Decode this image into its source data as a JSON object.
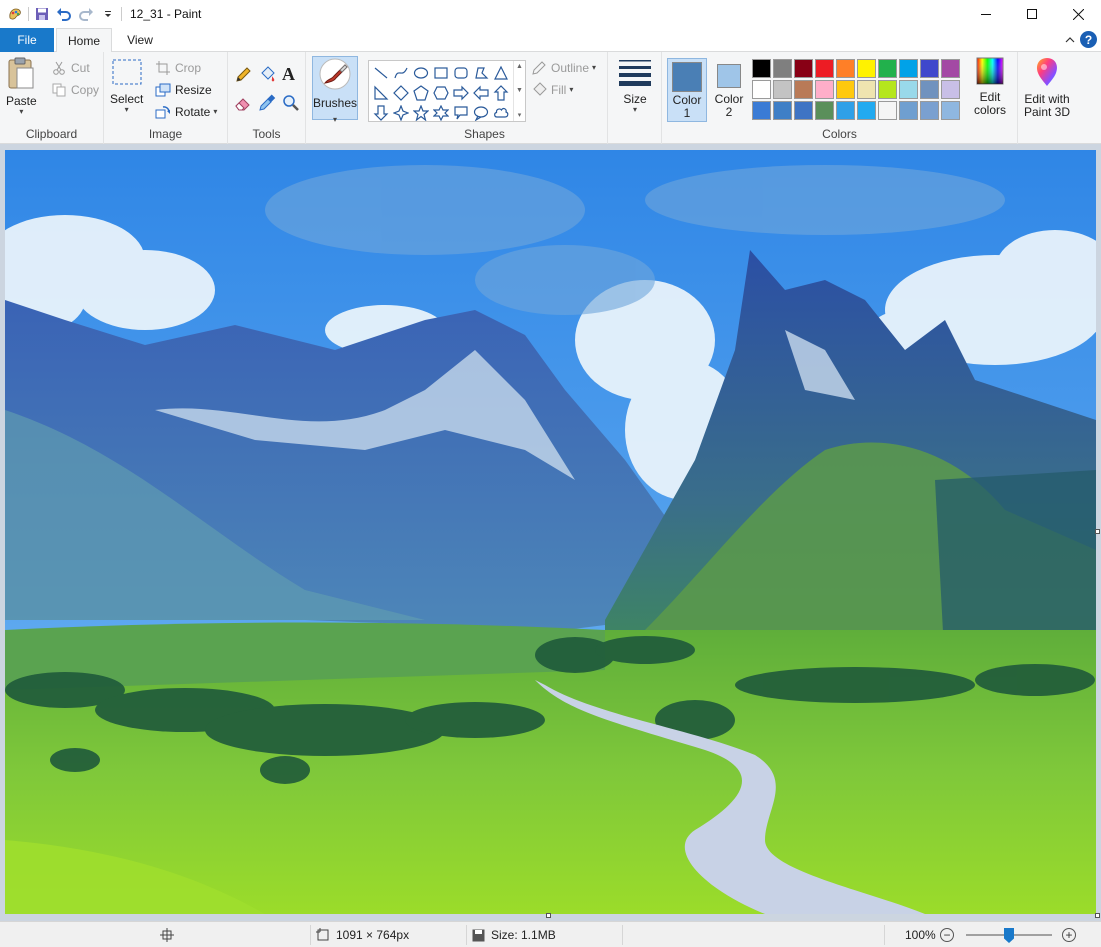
{
  "window": {
    "title": "12_31 - Paint",
    "minimize_icon": "minimize-icon",
    "maximize_icon": "maximize-icon",
    "close_icon": "close-icon"
  },
  "quick_access": [
    "paint-app-icon",
    "save-icon",
    "undo-icon",
    "redo-icon",
    "customize-dropdown-icon"
  ],
  "tabs": [
    {
      "label": "File",
      "active": false
    },
    {
      "label": "Home",
      "active": true
    },
    {
      "label": "View",
      "active": false
    }
  ],
  "ribbon": {
    "clipboard": {
      "group_label": "Clipboard",
      "paste": "Paste",
      "cut": "Cut",
      "copy": "Copy"
    },
    "image": {
      "group_label": "Image",
      "select": "Select",
      "crop": "Crop",
      "resize": "Resize",
      "rotate": "Rotate"
    },
    "tools": {
      "group_label": "Tools",
      "items": [
        "pencil-icon",
        "fill-bucket-icon",
        "text-icon",
        "eraser-icon",
        "color-picker-icon",
        "magnifier-icon"
      ]
    },
    "brushes": {
      "label": "Brushes"
    },
    "shapes": {
      "group_label": "Shapes",
      "outline": "Outline",
      "fill": "Fill"
    },
    "size": {
      "label": "Size"
    },
    "colors": {
      "group_label": "Colors",
      "color1_label": "Color\n1",
      "color1_value": "#4a7fb5",
      "color2_label": "Color\n2",
      "color2_value": "#9fc5e8",
      "edit_colors": "Edit\ncolors",
      "palette": [
        "#000000",
        "#7f7f7f",
        "#880015",
        "#ed1c24",
        "#ff7f27",
        "#fff200",
        "#22b14c",
        "#00a2e8",
        "#3f48cc",
        "#a349a4",
        "#ffffff",
        "#c3c3c3",
        "#b97a57",
        "#ffaec9",
        "#ffc90e",
        "#efe4b0",
        "#b5e61d",
        "#99d9ea",
        "#7092be",
        "#c8bfe7",
        "#3a7bd5",
        "#3f7fc6",
        "#3f74c4",
        "#5a8f5a",
        "#2fa0e8",
        "#22aaf0",
        "#f5f5f5",
        "#6f9fd0",
        "#7aa0d0",
        "#8fb7e0"
      ]
    },
    "paint3d": {
      "label": "Edit with\nPaint 3D"
    }
  },
  "status": {
    "dimensions": "1091 × 764px",
    "size": "Size: 1.1MB",
    "zoom": "100%"
  }
}
